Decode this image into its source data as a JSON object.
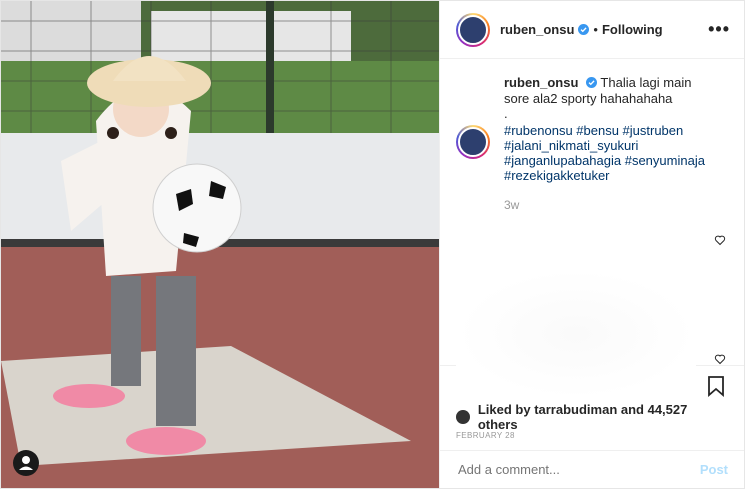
{
  "header": {
    "username": "ruben_onsu",
    "separator": "•",
    "follow_status": "Following",
    "more_label": "•••"
  },
  "caption": {
    "username": "ruben_onsu",
    "text": "Thalia lagi main sore ala2 sporty hahahahaha",
    "divider": ".",
    "hashtags": [
      "#rubenonsu #bensu #justruben",
      "#jalani_nikmati_syukuri",
      "#janganlupabahagia #senyuminaja",
      "#rezekigakketuker"
    ],
    "time_ago": "3w"
  },
  "likes": {
    "text": "Liked by tarrabudiman and 44,527 others"
  },
  "date": "FEBRUARY 28",
  "comment": {
    "placeholder": "Add a comment...",
    "post_label": "Post"
  },
  "colors": {
    "verified_blue": "#3897f0",
    "hashtag": "#003569",
    "post_disabled": "#b2dffc"
  }
}
